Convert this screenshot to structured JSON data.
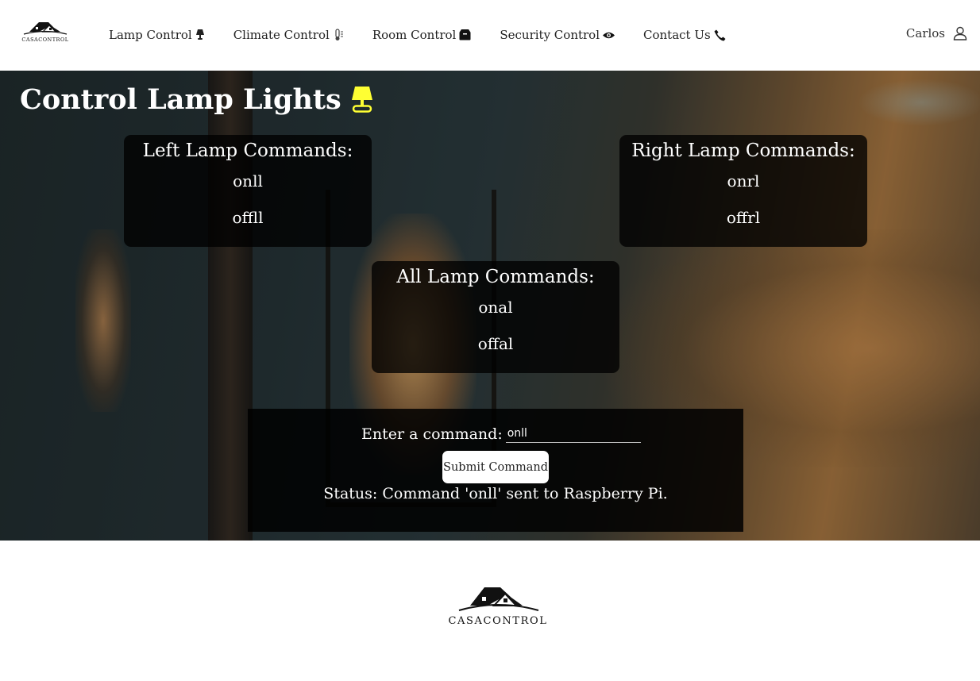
{
  "brand": {
    "name": "CASACONTROL"
  },
  "nav": {
    "items": [
      {
        "label": "Lamp Control",
        "icon": "lamp-icon"
      },
      {
        "label": "Climate Control",
        "icon": "thermometer-icon"
      },
      {
        "label": "Room Control",
        "icon": "box-icon"
      },
      {
        "label": "Security Control",
        "icon": "eye-icon"
      },
      {
        "label": "Contact Us",
        "icon": "phone-icon"
      }
    ]
  },
  "user": {
    "name": "Carlos",
    "icon": "user-icon"
  },
  "hero": {
    "title": "Control Lamp Lights",
    "title_icon": "yellow-lamp-icon",
    "accent_color": "#ffff33"
  },
  "boxes": {
    "left": {
      "title": "Left Lamp Commands:",
      "commands": [
        "onll",
        "offll"
      ]
    },
    "right": {
      "title": "Right Lamp Commands:",
      "commands": [
        "onrl",
        "offrl"
      ]
    },
    "all": {
      "title": "All Lamp Commands:",
      "commands": [
        "onal",
        "offal"
      ]
    }
  },
  "command": {
    "label": "Enter a command:",
    "value": "onll",
    "submit_label": "Submit Command",
    "status": "Status: Command 'onll' sent to Raspberry Pi."
  }
}
